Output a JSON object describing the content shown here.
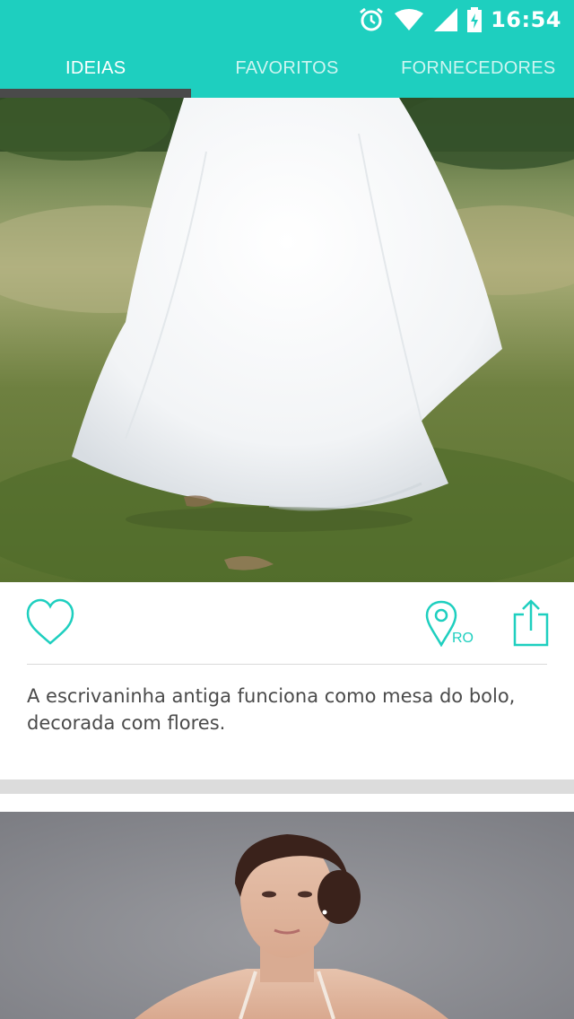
{
  "colors": {
    "accent": "#1ecfbf",
    "indicator": "#4a4a4a",
    "text": "#4a4a4a"
  },
  "status_bar": {
    "time": "16:54",
    "icons": [
      "alarm-icon",
      "wifi-icon",
      "signal-icon",
      "battery-charging-icon"
    ]
  },
  "tabs": [
    {
      "label": "IDEIAS",
      "active": true
    },
    {
      "label": "FAVORITOS",
      "active": false
    },
    {
      "label": "FORNECEDORES",
      "active": false
    }
  ],
  "cards": [
    {
      "image": "wedding-dress-photo",
      "location_code": "RO",
      "caption": "A escrivaninha antiga funciona como mesa do bolo, decorada com flores.",
      "actions": [
        "heart-icon",
        "location-pin-icon",
        "share-icon"
      ]
    },
    {
      "image": "bride-portrait-photo"
    }
  ]
}
